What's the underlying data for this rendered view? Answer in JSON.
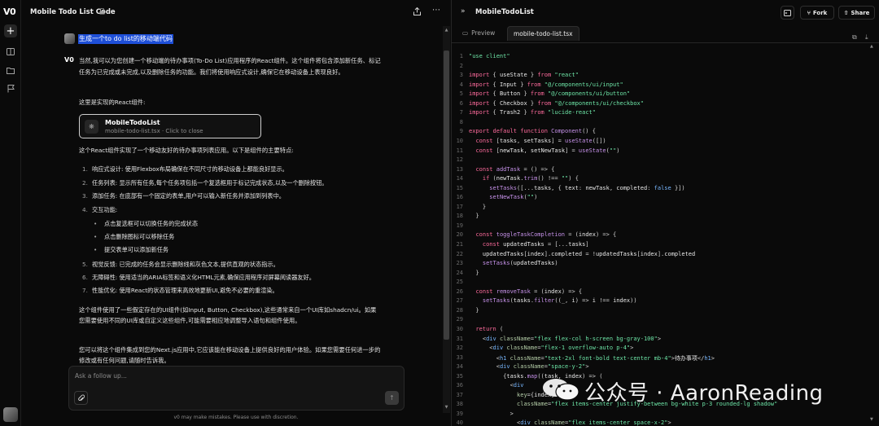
{
  "chat": {
    "title": "Mobile Todo List Code",
    "user_message": "生成一个to do list的移动端代码",
    "v0_label": "V0",
    "intro": "当然,我可以为您创建一个移动端的待办事项(To-Do List)应用程序的React组件。这个组件将包含添加新任务、标记任务为已完成或未完成,以及删除任务的功能。我们将使用响应式设计,确保它在移动设备上表现良好。",
    "pre_card": "这里是实现的React组件:",
    "card": {
      "name": "MobileTodoList",
      "sub": "mobile-todo-list.tsx · Click to close"
    },
    "features_intro": "这个React组件实现了一个移动友好的待办事项列表应用。以下是组件的主要特点:",
    "features": [
      {
        "num": "1.",
        "text": "响应式设计: 使用Flexbox布局确保在不同尺寸的移动设备上都能良好显示。"
      },
      {
        "num": "2.",
        "text": "任务列表: 显示所有任务,每个任务项包括一个复选框用于标记完成状态,以及一个删除按钮。"
      },
      {
        "num": "3.",
        "text": "添加任务: 在底部有一个固定的表单,用户可以输入新任务并添加到列表中。"
      },
      {
        "num": "4.",
        "text": "交互功能:"
      }
    ],
    "sub_features": [
      "点击复选框可以切换任务的完成状态",
      "点击删除图标可以移除任务",
      "提交表单可以添加新任务"
    ],
    "features_more": [
      {
        "num": "5.",
        "text": "视觉反馈: 已完成的任务会显示删除线和灰色文本,提供直观的状态指示。"
      },
      {
        "num": "6.",
        "text": "无障碍性: 使用适当的ARIA标签和语义化HTML元素,确保应用程序对屏幕阅读器友好。"
      },
      {
        "num": "7.",
        "text": "性能优化: 使用React的状态管理来高效地更新UI,避免不必要的重渲染。"
      }
    ],
    "para4": "这个组件使用了一些假定存在的UI组件(如Input, Button, Checkbox),这些通常来自一个UI库如shadcn/ui。如果您需要使用不同的UI库或自定义这些组件,可能需要相应地调整导入语句和组件使用。",
    "para5": "您可以将这个组件集成到您的Next.js应用中,它应该能在移动设备上提供良好的用户体验。如果您需要任何进一步的修改或有任何问题,请随时告诉我。",
    "input_placeholder": "Ask a follow up...",
    "disclaimer": "v0 may make mistakes. Please use with discretion."
  },
  "code_pane": {
    "title": "MobileTodoList",
    "fork_label": "Fork",
    "share_label": "Share",
    "tab_preview": "Preview",
    "tab_code": "mobile-todo-list.tsx",
    "lines": [
      [
        [
          "str",
          "\"use client\""
        ]
      ],
      [],
      [
        [
          "kw",
          "import"
        ],
        [
          "pun",
          " { "
        ],
        [
          "id",
          "useState"
        ],
        [
          "pun",
          " } "
        ],
        [
          "kw",
          "from"
        ],
        [
          "str",
          " \"react\""
        ]
      ],
      [
        [
          "kw",
          "import"
        ],
        [
          "pun",
          " { "
        ],
        [
          "id",
          "Input"
        ],
        [
          "pun",
          " } "
        ],
        [
          "kw",
          "from"
        ],
        [
          "str",
          " \"@/components/ui/input\""
        ]
      ],
      [
        [
          "kw",
          "import"
        ],
        [
          "pun",
          " { "
        ],
        [
          "id",
          "Button"
        ],
        [
          "pun",
          " } "
        ],
        [
          "kw",
          "from"
        ],
        [
          "str",
          " \"@/components/ui/button\""
        ]
      ],
      [
        [
          "kw",
          "import"
        ],
        [
          "pun",
          " { "
        ],
        [
          "id",
          "Checkbox"
        ],
        [
          "pun",
          " } "
        ],
        [
          "kw",
          "from"
        ],
        [
          "str",
          " \"@/components/ui/checkbox\""
        ]
      ],
      [
        [
          "kw",
          "import"
        ],
        [
          "pun",
          " { "
        ],
        [
          "id",
          "Trash2"
        ],
        [
          "pun",
          " } "
        ],
        [
          "kw",
          "from"
        ],
        [
          "str",
          " \"lucide-react\""
        ]
      ],
      [],
      [
        [
          "kw",
          "export default function"
        ],
        [
          "fn",
          " Component"
        ],
        [
          "pun",
          "() {"
        ]
      ],
      [
        [
          "pun",
          "  "
        ],
        [
          "kw",
          "const"
        ],
        [
          "pun",
          " ["
        ],
        [
          "id",
          "tasks"
        ],
        [
          "pun",
          ", "
        ],
        [
          "id",
          "setTasks"
        ],
        [
          "pun",
          "] = "
        ],
        [
          "fn",
          "useState"
        ],
        [
          "pun",
          "([])"
        ]
      ],
      [
        [
          "pun",
          "  "
        ],
        [
          "kw",
          "const"
        ],
        [
          "pun",
          " ["
        ],
        [
          "id",
          "newTask"
        ],
        [
          "pun",
          ", "
        ],
        [
          "id",
          "setNewTask"
        ],
        [
          "pun",
          "] = "
        ],
        [
          "fn",
          "useState"
        ],
        [
          "pun",
          "("
        ],
        [
          "str",
          "\"\""
        ],
        [
          "pun",
          ")"
        ]
      ],
      [],
      [
        [
          "pun",
          "  "
        ],
        [
          "kw",
          "const"
        ],
        [
          "fn",
          " addTask"
        ],
        [
          "pun",
          " = () => {"
        ]
      ],
      [
        [
          "pun",
          "    "
        ],
        [
          "kw",
          "if"
        ],
        [
          "pun",
          " ("
        ],
        [
          "id",
          "newTask"
        ],
        [
          "pun",
          "."
        ],
        [
          "fn",
          "trim"
        ],
        [
          "pun",
          "() !== "
        ],
        [
          "str",
          "\"\""
        ],
        [
          "pun",
          ") {"
        ]
      ],
      [
        [
          "pun",
          "      "
        ],
        [
          "fn",
          "setTasks"
        ],
        [
          "pun",
          "([..."
        ],
        [
          "id",
          "tasks"
        ],
        [
          "pun",
          ", { "
        ],
        [
          "id",
          "text"
        ],
        [
          "pun",
          ": "
        ],
        [
          "id",
          "newTask"
        ],
        [
          "pun",
          ", "
        ],
        [
          "id",
          "completed"
        ],
        [
          "pun",
          ": "
        ],
        [
          "bool",
          "false"
        ],
        [
          "pun",
          " }])"
        ]
      ],
      [
        [
          "pun",
          "      "
        ],
        [
          "fn",
          "setNewTask"
        ],
        [
          "pun",
          "("
        ],
        [
          "str",
          "\"\""
        ],
        [
          "pun",
          ")"
        ]
      ],
      [
        [
          "pun",
          "    }"
        ]
      ],
      [
        [
          "pun",
          "  }"
        ]
      ],
      [],
      [
        [
          "pun",
          "  "
        ],
        [
          "kw",
          "const"
        ],
        [
          "fn",
          " toggleTaskCompletion"
        ],
        [
          "pun",
          " = ("
        ],
        [
          "id",
          "index"
        ],
        [
          "pun",
          ") => {"
        ]
      ],
      [
        [
          "pun",
          "    "
        ],
        [
          "kw",
          "const"
        ],
        [
          "id",
          " updatedTasks"
        ],
        [
          "pun",
          " = [..."
        ],
        [
          "id",
          "tasks"
        ],
        [
          "pun",
          "]"
        ]
      ],
      [
        [
          "pun",
          "    "
        ],
        [
          "id",
          "updatedTasks"
        ],
        [
          "pun",
          "["
        ],
        [
          "id",
          "index"
        ],
        [
          "pun",
          "]."
        ],
        [
          "id",
          "completed"
        ],
        [
          "pun",
          " = !"
        ],
        [
          "id",
          "updatedTasks"
        ],
        [
          "pun",
          "["
        ],
        [
          "id",
          "index"
        ],
        [
          "pun",
          "]."
        ],
        [
          "id",
          "completed"
        ]
      ],
      [
        [
          "pun",
          "    "
        ],
        [
          "fn",
          "setTasks"
        ],
        [
          "pun",
          "("
        ],
        [
          "id",
          "updatedTasks"
        ],
        [
          "pun",
          ")"
        ]
      ],
      [
        [
          "pun",
          "  }"
        ]
      ],
      [],
      [
        [
          "pun",
          "  "
        ],
        [
          "kw",
          "const"
        ],
        [
          "fn",
          " removeTask"
        ],
        [
          "pun",
          " = ("
        ],
        [
          "id",
          "index"
        ],
        [
          "pun",
          ") => {"
        ]
      ],
      [
        [
          "pun",
          "    "
        ],
        [
          "fn",
          "setTasks"
        ],
        [
          "pun",
          "("
        ],
        [
          "id",
          "tasks"
        ],
        [
          "pun",
          "."
        ],
        [
          "fn",
          "filter"
        ],
        [
          "pun",
          "((_, "
        ],
        [
          "id",
          "i"
        ],
        [
          "pun",
          ") => "
        ],
        [
          "id",
          "i"
        ],
        [
          "pun",
          " !== "
        ],
        [
          "id",
          "index"
        ],
        [
          "pun",
          "))"
        ]
      ],
      [
        [
          "pun",
          "  }"
        ]
      ],
      [],
      [
        [
          "pun",
          "  "
        ],
        [
          "kw",
          "return"
        ],
        [
          "pun",
          " ("
        ]
      ],
      [
        [
          "pun",
          "    <"
        ],
        [
          "tag",
          "div"
        ],
        [
          "attr",
          " className"
        ],
        [
          "pun",
          "="
        ],
        [
          "str",
          "\"flex flex-col h-screen bg-gray-100\""
        ],
        [
          "pun",
          ">"
        ]
      ],
      [
        [
          "pun",
          "      <"
        ],
        [
          "tag",
          "div"
        ],
        [
          "attr",
          " className"
        ],
        [
          "pun",
          "="
        ],
        [
          "str",
          "\"flex-1 overflow-auto p-4\""
        ],
        [
          "pun",
          ">"
        ]
      ],
      [
        [
          "pun",
          "        <"
        ],
        [
          "tag",
          "h1"
        ],
        [
          "attr",
          " className"
        ],
        [
          "pun",
          "="
        ],
        [
          "str",
          "\"text-2xl font-bold text-center mb-4\""
        ],
        [
          "pun",
          ">"
        ],
        [
          "id",
          "待办事项"
        ],
        [
          "pun",
          "</"
        ],
        [
          "tag",
          "h1"
        ],
        [
          "pun",
          ">"
        ]
      ],
      [
        [
          "pun",
          "        <"
        ],
        [
          "tag",
          "div"
        ],
        [
          "attr",
          " className"
        ],
        [
          "pun",
          "="
        ],
        [
          "str",
          "\"space-y-2\""
        ],
        [
          "pun",
          ">"
        ]
      ],
      [
        [
          "pun",
          "          {"
        ],
        [
          "id",
          "tasks"
        ],
        [
          "pun",
          "."
        ],
        [
          "fn",
          "map"
        ],
        [
          "pun",
          "(("
        ],
        [
          "id",
          "task"
        ],
        [
          "pun",
          ", "
        ],
        [
          "id",
          "index"
        ],
        [
          "pun",
          ") => ("
        ]
      ],
      [
        [
          "pun",
          "            <"
        ],
        [
          "tag",
          "div"
        ]
      ],
      [
        [
          "pun",
          "              "
        ],
        [
          "attr",
          "key"
        ],
        [
          "pun",
          "={"
        ],
        [
          "id",
          "index"
        ],
        [
          "pun",
          "}"
        ]
      ],
      [
        [
          "pun",
          "              "
        ],
        [
          "attr",
          "className"
        ],
        [
          "pun",
          "="
        ],
        [
          "str",
          "\"flex items-center justify-between bg-white p-3 rounded-lg shadow\""
        ]
      ],
      [
        [
          "pun",
          "            >"
        ]
      ],
      [
        [
          "pun",
          "              <"
        ],
        [
          "tag",
          "div"
        ],
        [
          "attr",
          " className"
        ],
        [
          "pun",
          "="
        ],
        [
          "str",
          "\"flex items-center space-x-2\""
        ],
        [
          "pun",
          ">"
        ]
      ]
    ]
  },
  "watermark": {
    "text": "公众号 · AaronReading"
  },
  "icons": {
    "rail": [
      "plus-icon",
      "book-icon",
      "folder-icon",
      "flag-icon"
    ],
    "accent": "#1e4fd8"
  }
}
